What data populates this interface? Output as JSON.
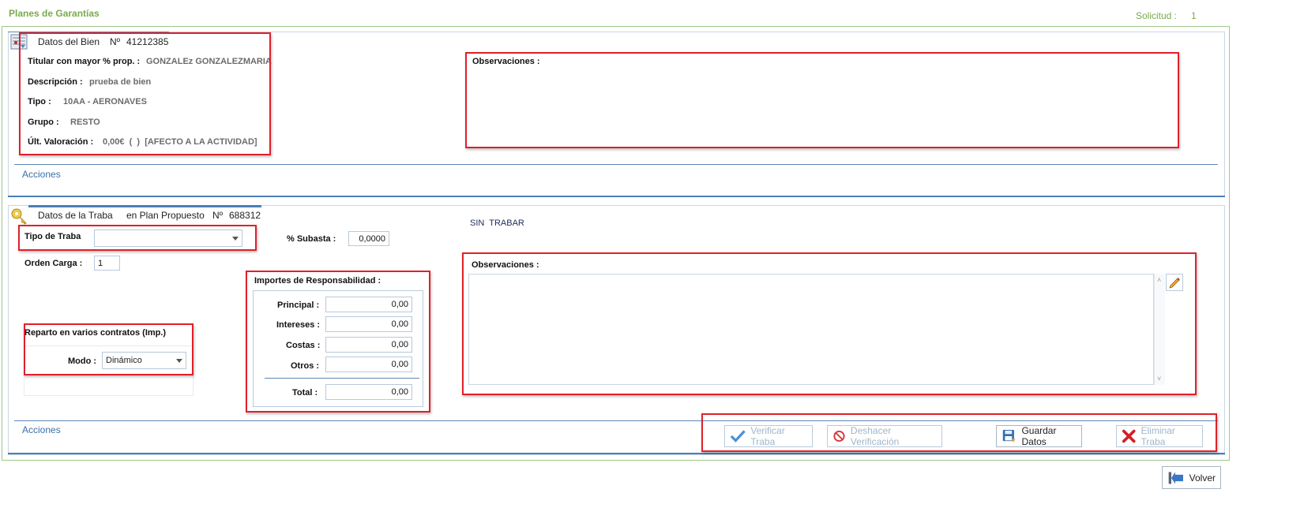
{
  "page": {
    "title": "Planes de Garantías",
    "solicitud_label": "Solicitud  :",
    "solicitud_value": "1"
  },
  "bien": {
    "header_title": "Datos del Bien",
    "header_num_label": "Nº",
    "header_num": "41212385",
    "titular_label": "Titular con mayor % prop. :",
    "titular_value": "GONZALEz GONZALEZMARIA",
    "descripcion_label": "Descripción :",
    "descripcion_value": "prueba de bien",
    "tipo_label": "Tipo :",
    "tipo_value": "10AA - AERONAVES",
    "grupo_label": "Grupo :",
    "grupo_value": "RESTO",
    "valoracion_label": "Últ. Valoración :",
    "valoracion_value": "0,00€  (  )  [AFECTO A LA ACTIVIDAD]",
    "observaciones_label": "Observaciones :",
    "acciones_label": "Acciones"
  },
  "traba": {
    "header_title": "Datos de la Traba",
    "header_plan": "en Plan Propuesto",
    "header_num_label": "Nº",
    "header_num": "688312",
    "estado": "SIN  TRABAR",
    "tipo_label": "Tipo de Traba",
    "tipo_value": "",
    "subasta_label": "% Subasta :",
    "subasta_value": "0,0000",
    "orden_label": "Orden Carga :",
    "orden_value": "1",
    "reparto_label": "Reparto en varios contratos (Imp.)",
    "modo_label": "Modo :",
    "modo_value": "Dinámico",
    "importes_title": "Importes de Responsabilidad  :",
    "principal_label": "Principal :",
    "principal_value": "0,00",
    "intereses_label": "Intereses :",
    "intereses_value": "0,00",
    "costas_label": "Costas :",
    "costas_value": "0,00",
    "otros_label": "Otros :",
    "otros_value": "0,00",
    "total_label": "Total :",
    "total_value": "0,00",
    "observaciones_label": "Observaciones :",
    "acciones_label": "Acciones"
  },
  "actions": {
    "verificar": "Verificar Traba",
    "deshacer": "Deshacer Verificación",
    "guardar": "Guardar Datos",
    "eliminar": "Eliminar Traba",
    "volver": "Volver"
  },
  "colors": {
    "accent_green": "#7aaa4e",
    "accent_blue": "#4a7fb5",
    "highlight_red": "#e0202a",
    "disabled_text": "#9fb6cb"
  },
  "icons": [
    "bien-icon",
    "traba-key-icon",
    "check-icon",
    "forbidden-icon",
    "save-disk-icon",
    "red-x-icon",
    "edit-pencil-icon",
    "back-arrow-icon",
    "chevron-down-icon"
  ]
}
